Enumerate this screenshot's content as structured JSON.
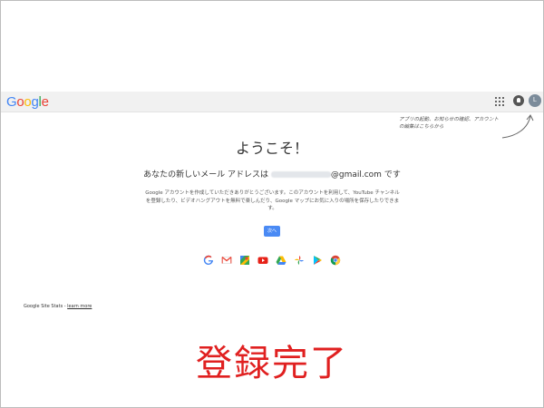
{
  "header": {
    "logo": [
      "G",
      "o",
      "o",
      "g",
      "l",
      "e"
    ],
    "logo_colors": [
      "#4285f4",
      "#ea4335",
      "#fbbc05",
      "#4285f4",
      "#34a853",
      "#ea4335"
    ],
    "avatar_initial": "L"
  },
  "hint": {
    "text": "アプリの起動、お知らせの確認、アカウントの編集はこちらから"
  },
  "main": {
    "welcome": "ようこそ！",
    "address_prefix": "あなたの新しいメール アドレスは",
    "address_domain": "@gmail.com",
    "address_suffix": "です",
    "description": "Google アカウントを作成していただきありがとうございます。このアカウントを利用して、YouTube チャンネルを登録したり、ビデオハングアウトを無料で楽しんだり、Google マップにお気に入りの場所を保存したりできます。",
    "next_label": "次へ"
  },
  "app_icons": [
    "google-search-icon",
    "gmail-icon",
    "maps-icon",
    "youtube-icon",
    "drive-icon",
    "photos-icon",
    "play-store-icon",
    "chrome-icon"
  ],
  "footer": {
    "label": "Google Site Stats - ",
    "link": "learn more"
  },
  "overlay": {
    "complete_text": "登録完了",
    "color": "#e02020"
  }
}
